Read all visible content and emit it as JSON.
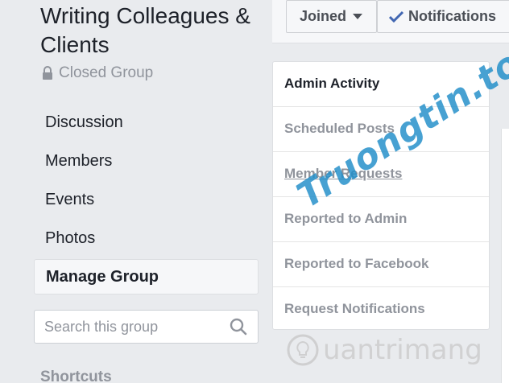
{
  "group": {
    "title": "Writing Colleagues & Clients",
    "privacy": "Closed Group"
  },
  "nav": {
    "items": [
      {
        "label": "Discussion"
      },
      {
        "label": "Members"
      },
      {
        "label": "Events"
      },
      {
        "label": "Photos"
      },
      {
        "label": "Manage Group"
      }
    ]
  },
  "search": {
    "placeholder": "Search this group"
  },
  "shortcuts": {
    "label": "Shortcuts"
  },
  "actions": {
    "joined_label": "Joined",
    "notifications_label": "Notifications"
  },
  "manage_panel": {
    "items": [
      {
        "label": "Admin Activity"
      },
      {
        "label": "Scheduled Posts"
      },
      {
        "label": "Member Requests"
      },
      {
        "label": "Reported to Admin"
      },
      {
        "label": "Reported to Facebook"
      },
      {
        "label": "Request Notifications"
      }
    ]
  },
  "watermarks": {
    "top": "Truongtin.top",
    "bottom": "uantrimang"
  },
  "colors": {
    "background": "#e9ebee",
    "text": "#1d2129",
    "muted": "#90949c",
    "accent": "#4267b2",
    "watermark": "#1e8cc8"
  },
  "icons": [
    "lock-icon",
    "search-icon",
    "caret-down-icon",
    "check-icon",
    "lightbulb-icon"
  ]
}
